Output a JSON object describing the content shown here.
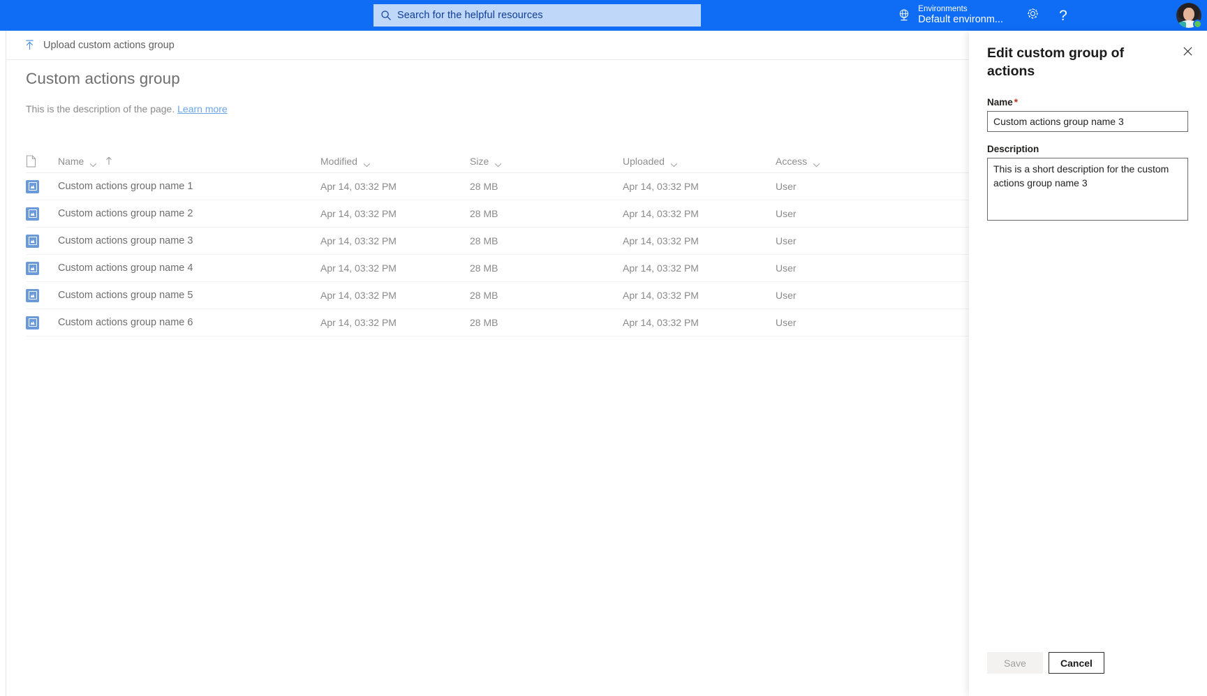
{
  "topbar": {
    "search": {
      "placeholder": "Search for the helpful resources",
      "icon": "search-icon"
    },
    "environments": {
      "icon": "globe-environment-icon",
      "label": "Environments",
      "value": "Default environm..."
    },
    "settings_icon": "gear-icon",
    "help_icon": "question-mark-help-icon",
    "avatar": {
      "name": "user-avatar",
      "presence": "available-green"
    },
    "background_color": "#0f6cf5",
    "search_background": "#bfd8fa"
  },
  "commandbar": {
    "upload_icon": "upload-arrow-icon",
    "upload_label": "Upload custom actions group"
  },
  "page": {
    "title": "Custom actions group",
    "description": "This is the description of the page.",
    "learn_more": "Learn more"
  },
  "table": {
    "columns": [
      {
        "key": "icon",
        "label": "",
        "chevron": false,
        "sorted": false
      },
      {
        "key": "name",
        "label": "Name",
        "chevron": true,
        "sorted": true,
        "sort_direction": "ascending"
      },
      {
        "key": "modified",
        "label": "Modified",
        "chevron": true,
        "sorted": false
      },
      {
        "key": "size",
        "label": "Size",
        "chevron": true,
        "sorted": false
      },
      {
        "key": "uploaded",
        "label": "Uploaded",
        "chevron": true,
        "sorted": false
      },
      {
        "key": "access",
        "label": "Access",
        "chevron": true,
        "sorted": false
      }
    ],
    "rows": [
      {
        "icon": "custom-actions-group-icon",
        "name": "Custom actions group name 1",
        "modified": "Apr 14, 03:32 PM",
        "size": "28 MB",
        "uploaded": "Apr 14, 03:32 PM",
        "access": "User"
      },
      {
        "icon": "custom-actions-group-icon",
        "name": "Custom actions group name 2",
        "modified": "Apr 14, 03:32 PM",
        "size": "28 MB",
        "uploaded": "Apr 14, 03:32 PM",
        "access": "User"
      },
      {
        "icon": "custom-actions-group-icon",
        "name": "Custom actions group name 3",
        "modified": "Apr 14, 03:32 PM",
        "size": "28 MB",
        "uploaded": "Apr 14, 03:32 PM",
        "access": "User"
      },
      {
        "icon": "custom-actions-group-icon",
        "name": "Custom actions group name 4",
        "modified": "Apr 14, 03:32 PM",
        "size": "28 MB",
        "uploaded": "Apr 14, 03:32 PM",
        "access": "User"
      },
      {
        "icon": "custom-actions-group-icon",
        "name": "Custom actions group name 5",
        "modified": "Apr 14, 03:32 PM",
        "size": "28 MB",
        "uploaded": "Apr 14, 03:32 PM",
        "access": "User"
      },
      {
        "icon": "custom-actions-group-icon",
        "name": "Custom actions group name 6",
        "modified": "Apr 14, 03:32 PM",
        "size": "28 MB",
        "uploaded": "Apr 14, 03:32 PM",
        "access": "User"
      }
    ]
  },
  "panel": {
    "title": "Edit custom group of actions",
    "close_icon": "close-icon",
    "name_label": "Name",
    "name_required_marker": "*",
    "name_value": "Custom actions group name 3",
    "description_label": "Description",
    "description_value": "This is a short description for the custom actions group name 3",
    "save_label": "Save",
    "save_enabled": false,
    "cancel_label": "Cancel",
    "required_color": "#c52a1a"
  }
}
